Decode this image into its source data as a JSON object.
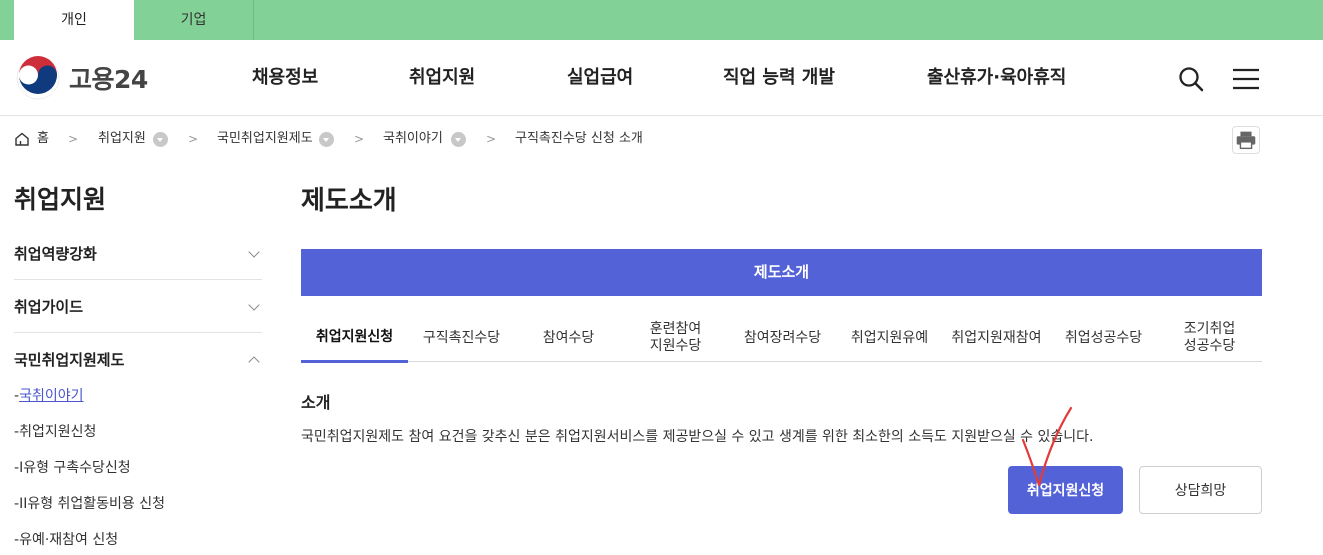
{
  "topbar": {
    "tabs": [
      "개인",
      "기업"
    ]
  },
  "header": {
    "logo_text": "고용24",
    "nav": [
      "채용정보",
      "취업지원",
      "실업급여",
      "직업 능력 개발",
      "출산휴가·육아휴직"
    ],
    "icons": [
      "search-icon",
      "menu-icon"
    ]
  },
  "breadcrumb": {
    "home": "홈",
    "items": [
      "취업지원",
      "국민취업지원제도",
      "국취이야기",
      "구직촉진수당 신청 소개"
    ]
  },
  "sidebar": {
    "title": "취업지원",
    "menus": [
      "취업역량강화",
      "취업가이드",
      "국민취업지원제도"
    ],
    "subitems": [
      "국취이야기",
      "취업지원신청",
      "I유형 구촉수당신청",
      "II유형 취업활동비용 신청",
      "유예·재참여 신청"
    ],
    "sub_prefix": "-"
  },
  "content": {
    "page_title": "제도소개",
    "main_tab": "제도소개",
    "subtabs": [
      [
        "취업지원신청"
      ],
      [
        "구직촉진수당"
      ],
      [
        "참여수당"
      ],
      [
        "훈련참여",
        "지원수당"
      ],
      [
        "참여장려수당"
      ],
      [
        "취업지원유예"
      ],
      [
        "취업지원재참여"
      ],
      [
        "취업성공수당"
      ],
      [
        "조기취업",
        "성공수당"
      ]
    ],
    "section_title": "소개",
    "section_desc": "국민취업지원제도 참여 요건을 갖추신 분은 취업지원서비스를 제공받으실 수 있고 생계를 위한 최소한의 소득도 지원받으실 수 있습니다.",
    "apply_button": "취업지원신청",
    "consult_button": "상담희망"
  },
  "colors": {
    "topbar": "#82d196",
    "accent": "#5462d8",
    "annotation": "#e23b3b"
  }
}
